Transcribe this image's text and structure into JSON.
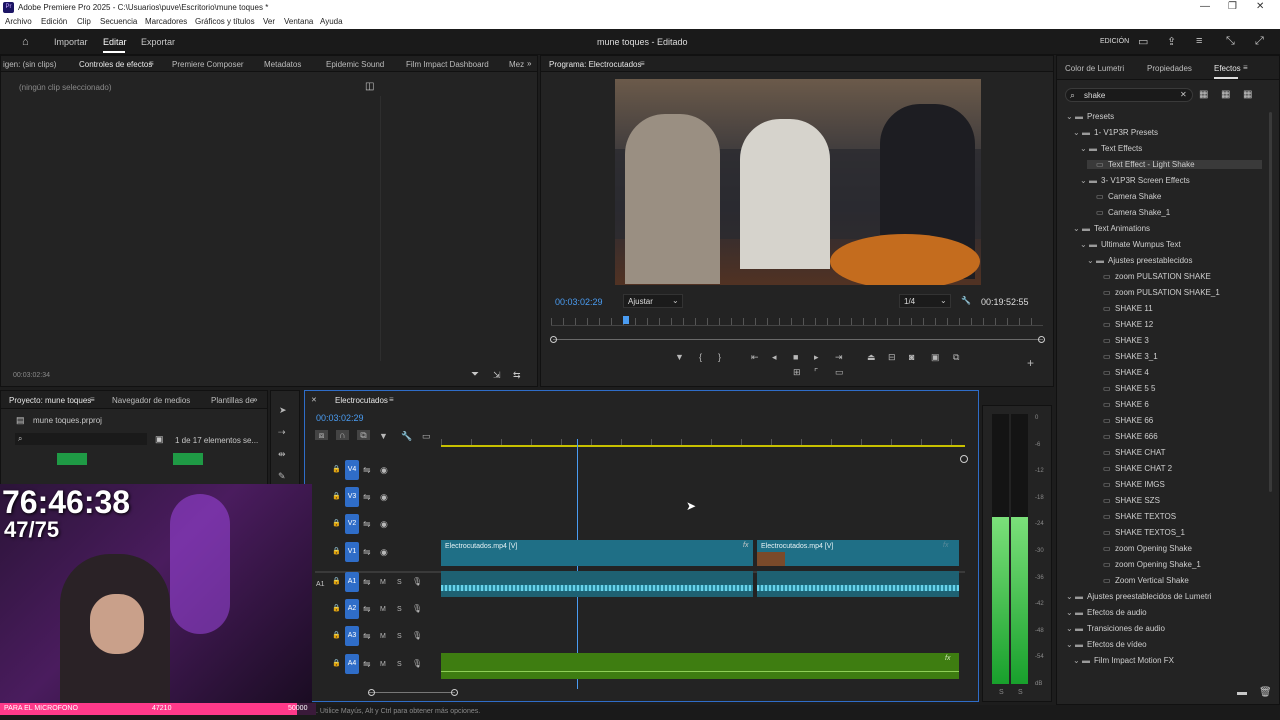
{
  "app": {
    "title": "Adobe Premiere Pro 2025 - C:\\Usuarios\\puve\\Escritorio\\mune toques *"
  },
  "menu": [
    "Archivo",
    "Edición",
    "Clip",
    "Secuencia",
    "Marcadores",
    "Gráficos y títulos",
    "Ver",
    "Ventana",
    "Ayuda"
  ],
  "workspace": {
    "tabs": [
      "Importar",
      "Editar",
      "Exportar"
    ],
    "project_title": "mune toques - Editado",
    "mode": "EDICIÓN"
  },
  "effect_controls": {
    "tabs": [
      "igen: (sin clips)",
      "Controles de efectos",
      "Premiere Composer",
      "Metadatos",
      "Epidemic Sound",
      "Film Impact Dashboard",
      "Mez"
    ],
    "empty_text": "(ningún clip seleccionado)",
    "timecode": "00:03:02:34"
  },
  "program": {
    "title": "Programa: Electrocutados",
    "timecode": "00:03:02:29",
    "fit": "Ajustar",
    "resolution": "1/4",
    "duration": "00:19:52:55"
  },
  "project": {
    "tabs": [
      "Proyecto: mune toques",
      "Navegador de medios",
      "Plantillas de"
    ],
    "file": "mune toques.prproj",
    "count": "1 de 17 elementos se..."
  },
  "timeline": {
    "sequence": "Electrocutados",
    "timecode": "00:03:02:29",
    "video_tracks": [
      "V4",
      "V3",
      "V2",
      "V1"
    ],
    "audio_tracks": [
      "A1",
      "A2",
      "A3",
      "A4"
    ],
    "source_patch": "A1",
    "clip1": "Electrocutados.mp4 [V]",
    "clip2": "Electrocutados.mp4 [V]",
    "fx": "fx",
    "track_m": "M",
    "track_s": "S",
    "playhead_fraction": 0.26
  },
  "meter": {
    "scale": [
      "0",
      "-6",
      "-12",
      "-18",
      "-24",
      "-30",
      "-36",
      "-42",
      "-48",
      "-54",
      "dB"
    ],
    "labels": [
      "S",
      "S"
    ],
    "level": 0.62
  },
  "effects_panel": {
    "tabs": [
      "Color de Lumetri",
      "Propiedades",
      "Efectos"
    ],
    "search": "shake",
    "tree": [
      {
        "label": "Presets",
        "depth": 0,
        "folder": true
      },
      {
        "label": "1- V1P3R Presets",
        "depth": 1,
        "folder": true
      },
      {
        "label": "Text Effects",
        "depth": 2,
        "folder": true
      },
      {
        "label": "Text Effect - Light Shake",
        "depth": 3,
        "folder": false,
        "selected": true
      },
      {
        "label": "3- V1P3R Screen Effects",
        "depth": 2,
        "folder": true
      },
      {
        "label": "Camera Shake",
        "depth": 3,
        "folder": false
      },
      {
        "label": "Camera Shake_1",
        "depth": 3,
        "folder": false
      },
      {
        "label": "Text Animations",
        "depth": 1,
        "folder": true
      },
      {
        "label": "Ultimate Wumpus Text",
        "depth": 2,
        "folder": true
      },
      {
        "label": "Ajustes preestablecidos",
        "depth": 3,
        "folder": true
      },
      {
        "label": "zoom PULSATION SHAKE",
        "depth": 4,
        "folder": false
      },
      {
        "label": "zoom PULSATION SHAKE_1",
        "depth": 4,
        "folder": false
      },
      {
        "label": "SHAKE 11",
        "depth": 4,
        "folder": false
      },
      {
        "label": "SHAKE 12",
        "depth": 4,
        "folder": false
      },
      {
        "label": "SHAKE 3",
        "depth": 4,
        "folder": false
      },
      {
        "label": "SHAKE 3_1",
        "depth": 4,
        "folder": false
      },
      {
        "label": "SHAKE 4",
        "depth": 4,
        "folder": false
      },
      {
        "label": "SHAKE 5 5",
        "depth": 4,
        "folder": false
      },
      {
        "label": "SHAKE 6",
        "depth": 4,
        "folder": false
      },
      {
        "label": "SHAKE 66",
        "depth": 4,
        "folder": false
      },
      {
        "label": "SHAKE 666",
        "depth": 4,
        "folder": false
      },
      {
        "label": "SHAKE CHAT",
        "depth": 4,
        "folder": false
      },
      {
        "label": "SHAKE CHAT 2",
        "depth": 4,
        "folder": false
      },
      {
        "label": "SHAKE IMGS",
        "depth": 4,
        "folder": false
      },
      {
        "label": "SHAKE SZS",
        "depth": 4,
        "folder": false
      },
      {
        "label": "SHAKE TEXTOS",
        "depth": 4,
        "folder": false
      },
      {
        "label": "SHAKE TEXTOS_1",
        "depth": 4,
        "folder": false
      },
      {
        "label": "zoom Opening Shake",
        "depth": 4,
        "folder": false
      },
      {
        "label": "zoom Opening Shake_1",
        "depth": 4,
        "folder": false
      },
      {
        "label": "Zoom Vertical Shake",
        "depth": 4,
        "folder": false
      },
      {
        "label": "Ajustes preestablecidos de Lumetri",
        "depth": 0,
        "folder": true
      },
      {
        "label": "Efectos de audio",
        "depth": 0,
        "folder": true
      },
      {
        "label": "Transiciones de audio",
        "depth": 0,
        "folder": true
      },
      {
        "label": "Efectos de vídeo",
        "depth": 0,
        "folder": true
      },
      {
        "label": "Film Impact Motion FX",
        "depth": 1,
        "folder": true
      }
    ]
  },
  "status": {
    "text": ". Utilice Mayús, Alt y Ctrl para obtener más opciones."
  },
  "overlay": {
    "timer": "76:46:38",
    "counter": "47/75",
    "mic_label": "PARA EL MICROFONO",
    "mic_value": "47210",
    "mic_goal": "50000",
    "mic_fraction": 0.94
  }
}
